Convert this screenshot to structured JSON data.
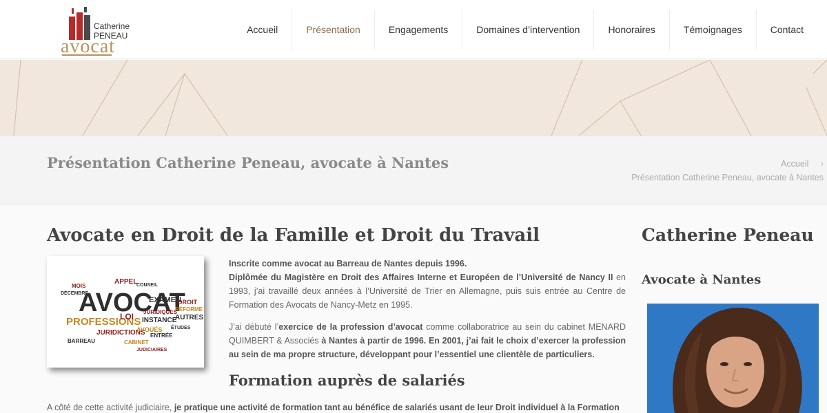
{
  "logo": {
    "first_name": "Catherine",
    "last_name": "PENEAU",
    "word": "avocat",
    "colors": {
      "red": "#b52a2a",
      "dark": "#4a4a4a",
      "gold": "#b9915a"
    }
  },
  "nav": {
    "items": [
      {
        "label": "Accueil",
        "active": false
      },
      {
        "label": "Présentation",
        "active": true
      },
      {
        "label": "Engagements",
        "active": false
      },
      {
        "label": "Domaines d’intervention",
        "active": false
      },
      {
        "label": "Honoraires",
        "active": false
      },
      {
        "label": "Témoignages",
        "active": false
      },
      {
        "label": "Contact",
        "active": false
      }
    ]
  },
  "titlebar": {
    "title": "Présentation Catherine Peneau, avocate à Nantes",
    "breadcrumb_home": "Accueil",
    "breadcrumb_sep": "›",
    "breadcrumb_current": "Présentation Catherine Peneau, avocate à Nantes"
  },
  "main": {
    "heading": "Avocate en Droit de la Famille et Droit du Travail",
    "word_cloud": {
      "big_word": "AVOCAT",
      "words": [
        "PROFESSIONS",
        "JURIDICTIONS",
        "EXAMEN",
        "INSTANCE",
        "AUTRES",
        "DROIT",
        "APPEL",
        "RÉFORME",
        "JURIDIQUES",
        "BARREAU",
        "CONSEIL",
        "CABINET",
        "LOI",
        "AVOUÉS",
        "ENTRÉE",
        "JUDICIAIRES",
        "ÉTUDES",
        "DÉCEMBRE",
        "MOIS"
      ]
    },
    "p1_b1": "Inscrite comme avocat au Barreau de Nantes depuis 1996.",
    "p1_b2": "Diplômée du Magistère en Droit des Affaires Interne et Européen de l’Université de Nancy II",
    "p1_t1": " en 1993, j’ai travaillé deux années à l’Université de Trier en Allemagne, puis suis entrée au Centre de Formation des Avocats de Nancy-Metz en 1995.",
    "p2_t1": "J’ai débuté l’",
    "p2_b1": "exercice de la profession d’avocat",
    "p2_t2": " comme collaboratrice au sein du cabinet MENARD QUIMBERT & Associés ",
    "p2_b2": "à Nantes à partir de 1996. En 2001, j’ai fait le choix d’exercer la profession au sein de ma propre structure, développant pour l’essentiel une clientèle de particuliers.",
    "subheading": "Formation auprès de salariés",
    "p3_t1": "A côté de cette activité judiciaire, ",
    "p3_b1": "je pratique une activité de formation tant au bénéfice de salariés usant de leur Droit individuel à la Formation"
  },
  "sidebar": {
    "title": "Catherine Peneau",
    "subtitle": "Avocate à Nantes"
  }
}
